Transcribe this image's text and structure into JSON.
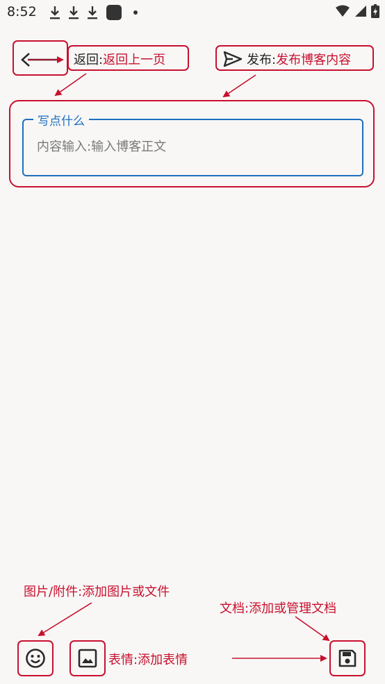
{
  "status_bar": {
    "time": "8:52"
  },
  "toolbar": {
    "back_label": "返回:",
    "back_desc": "返回上一页",
    "publish_label": "发布:",
    "publish_desc": "发布博客内容"
  },
  "editor": {
    "label": "写点什么",
    "placeholder": "内容输入:输入博客正文"
  },
  "bottom": {
    "attach_annotation": "图片/附件:添加图片或文件",
    "emoji_annotation": "表情:添加表情",
    "doc_annotation": "文档:添加或管理文档"
  },
  "colors": {
    "accent": "#1d6fc0",
    "annotation": "#c8102e"
  }
}
